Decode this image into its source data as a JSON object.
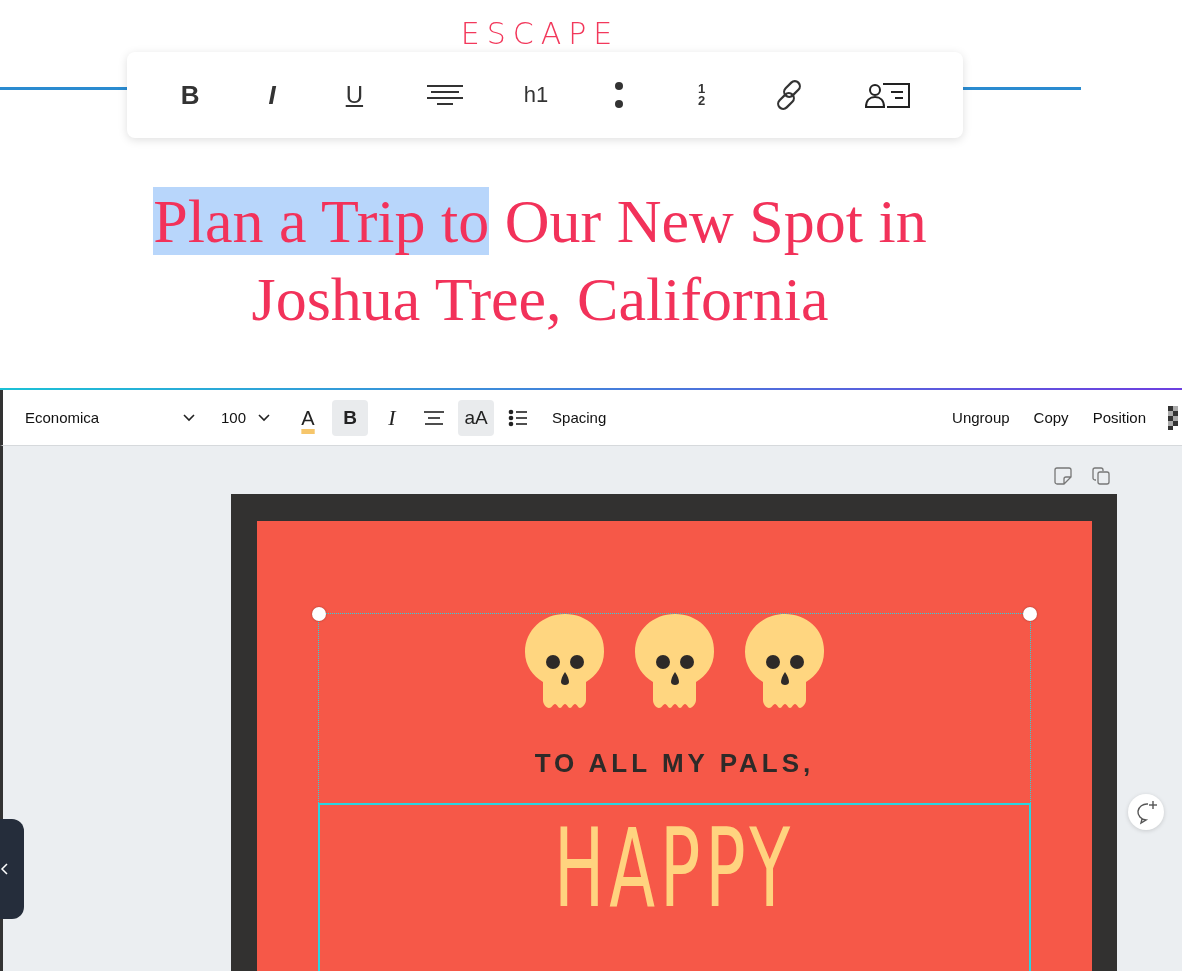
{
  "brand": {
    "text": "ESCAPE"
  },
  "format_toolbar": [
    {
      "kind": "bold",
      "label": "B"
    },
    {
      "kind": "italic",
      "label": "I"
    },
    {
      "kind": "underline",
      "label": "U"
    },
    {
      "kind": "align"
    },
    {
      "kind": "heading",
      "label": "h1"
    },
    {
      "kind": "dots"
    },
    {
      "kind": "fraction",
      "numerator": "1",
      "denominator": "2"
    },
    {
      "kind": "link"
    },
    {
      "kind": "contact"
    }
  ],
  "headline": {
    "parts": [
      {
        "text": "Plan a Trip to",
        "selected": true
      },
      {
        "text": " Our New Spot in Joshua Tree, California",
        "selected": false
      }
    ]
  },
  "editor_toolbar": {
    "font": "Economica",
    "size": "100",
    "color_label": "A",
    "tools": [
      {
        "kind": "bold",
        "label": "B",
        "active": true
      },
      {
        "kind": "italic",
        "label": "I",
        "active": false
      },
      {
        "kind": "align",
        "active": false
      },
      {
        "kind": "case",
        "label": "aA",
        "active": true
      },
      {
        "kind": "list",
        "active": false
      },
      {
        "kind": "text",
        "label": "Spacing",
        "active": false
      }
    ],
    "actions": [
      "Ungroup",
      "Copy",
      "Position"
    ]
  },
  "design": {
    "greeting": "TO ALL MY PALS,",
    "title": "HAPPY"
  }
}
